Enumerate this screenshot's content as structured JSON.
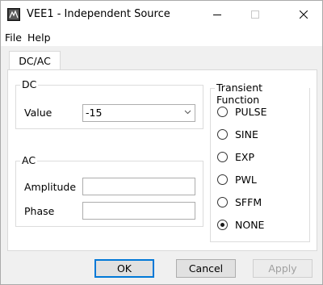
{
  "window": {
    "title": "VEE1 - Independent Source"
  },
  "menu": {
    "file": "File",
    "help": "Help"
  },
  "tab": {
    "label": "DC/AC"
  },
  "dc": {
    "title": "DC",
    "value_label": "Value",
    "value": "-15"
  },
  "ac": {
    "title": "AC",
    "amplitude_label": "Amplitude",
    "amplitude": "",
    "phase_label": "Phase",
    "phase": ""
  },
  "transient": {
    "title": "Transient Function",
    "options": [
      "PULSE",
      "SINE",
      "EXP",
      "PWL",
      "SFFM",
      "NONE"
    ],
    "selected": "NONE"
  },
  "buttons": {
    "ok": "OK",
    "cancel": "Cancel",
    "apply": "Apply"
  }
}
